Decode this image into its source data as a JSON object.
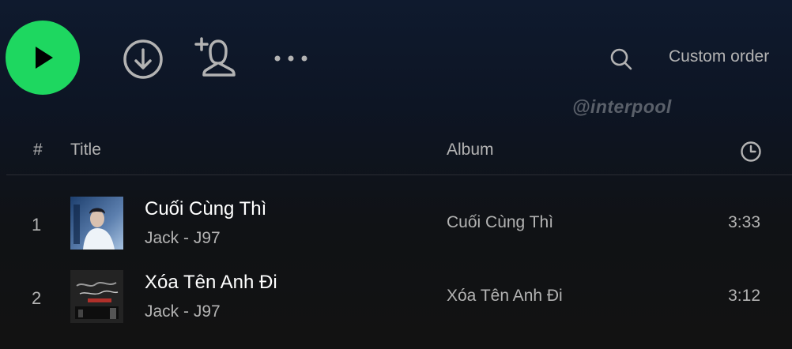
{
  "action_bar": {
    "play_icon": "play-icon",
    "download_icon": "download-circle-icon",
    "follow_icon": "add-user-icon",
    "more_icon": "more-horizontal-icon",
    "search_icon": "search-icon",
    "sort_label": "Custom order"
  },
  "watermark": "@interpool",
  "list_header": {
    "number": "#",
    "title": "Title",
    "album": "Album",
    "duration_icon": "clock-icon"
  },
  "tracks": [
    {
      "number": "1",
      "title": "Cuối Cùng Thì",
      "artist": "Jack - J97",
      "album": "Cuối Cùng Thì",
      "duration": "3:33"
    },
    {
      "number": "2",
      "title": "Xóa Tên Anh Đi",
      "artist": "Jack - J97",
      "album": "Xóa Tên Anh Đi",
      "duration": "3:12"
    }
  ],
  "colors": {
    "accent": "#1ed760",
    "text_primary": "#ffffff",
    "text_secondary": "#b3b3b3"
  }
}
